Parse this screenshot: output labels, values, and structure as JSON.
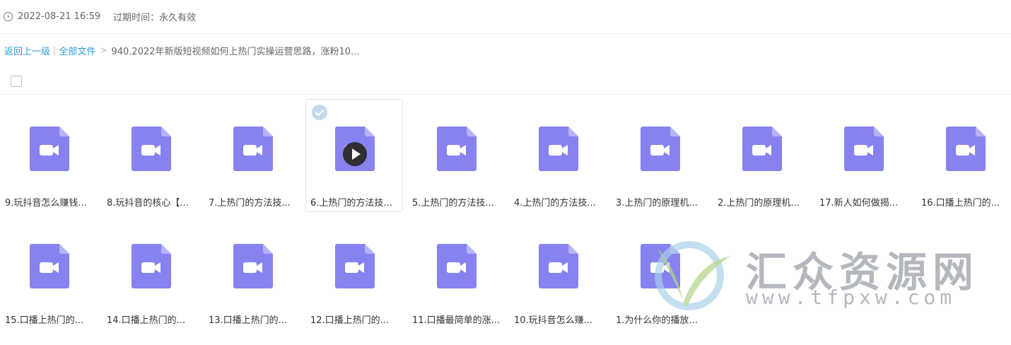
{
  "header": {
    "datetime": "2022-08-21 16:59",
    "expire": "过期时间：永久有效"
  },
  "breadcrumb": {
    "back": "返回上一级",
    "separator": "|",
    "all_files": "全部文件",
    "arrow": ">",
    "current": "940.2022年新版短视频如何上热门实操运营思路，涨粉10..."
  },
  "colors": {
    "file_icon": "#8682f0",
    "file_icon_fold": "#b6b3f6",
    "link": "#2d9cdb",
    "selected_border": "#d9e7f5",
    "check_badge": "#c5d8ec"
  },
  "files": [
    {
      "name": "9.玩抖音怎么赚钱..."
    },
    {
      "name": "8.玩抖音的核心【..."
    },
    {
      "name": "7.上热门的方法技..."
    },
    {
      "name": "6.上热门的方法技...",
      "selected": true
    },
    {
      "name": "5.上热门的方法技..."
    },
    {
      "name": "4.上热门的方法技..."
    },
    {
      "name": "3.上热门的原理机..."
    },
    {
      "name": "2.上热门的原理机..."
    },
    {
      "name": "17.新人如何做揭..."
    },
    {
      "name": "16.口播上热门的..."
    },
    {
      "name": "15.口播上热门的..."
    },
    {
      "name": "14.口播上热门的..."
    },
    {
      "name": "13.口播上热门的..."
    },
    {
      "name": "12.口播上热门的..."
    },
    {
      "name": "11.口播最简单的涨..."
    },
    {
      "name": "10.玩抖音怎么赚..."
    },
    {
      "name": "1.为什么你的播放..."
    }
  ],
  "watermark": {
    "title": "汇众资源网",
    "url": "www.tfpxw.com"
  }
}
